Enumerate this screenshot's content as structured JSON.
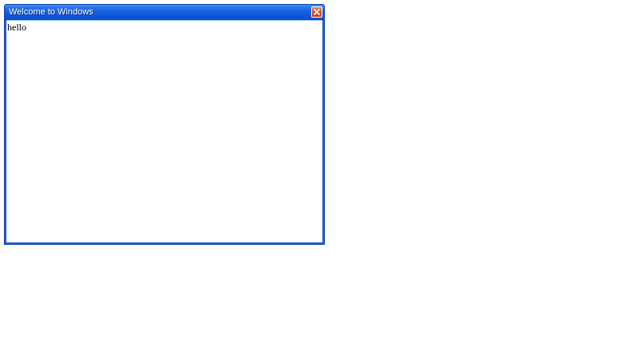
{
  "window": {
    "title": "Welcome to Windows",
    "content_text": "hello",
    "close_icon": "close-icon"
  },
  "colors": {
    "titlebar_blue": "#1a63e0",
    "frame_blue": "#1f5fd0",
    "close_red": "#d9532f",
    "background": "#ffffff"
  }
}
